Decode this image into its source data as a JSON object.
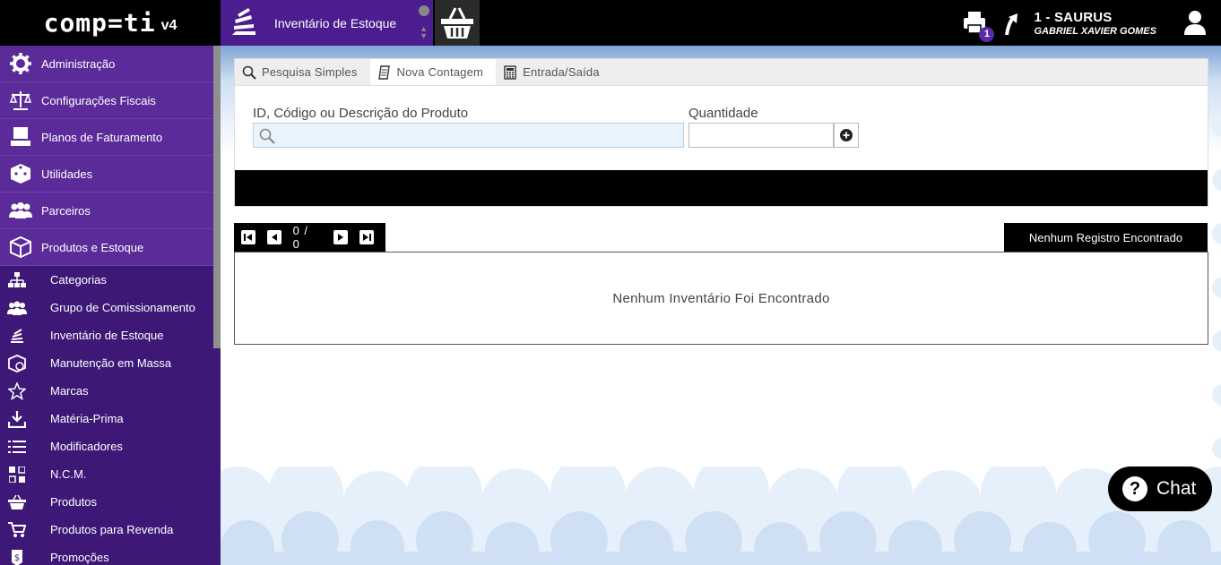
{
  "app": {
    "brand": "comp=ti",
    "version": "v4"
  },
  "open_tab": {
    "label": "Inventário de Estoque"
  },
  "header": {
    "print_badge": "1",
    "company": "1 - SAURUS",
    "user": "GABRIEL XAVIER GOMES"
  },
  "sidebar": {
    "items": [
      {
        "label": "Administração",
        "icon": "gear-icon"
      },
      {
        "label": "Configurações Fiscais",
        "icon": "scales-icon"
      },
      {
        "label": "Planos de Faturamento",
        "icon": "billing-icon"
      },
      {
        "label": "Utilidades",
        "icon": "dice-icon"
      },
      {
        "label": "Parceiros",
        "icon": "people-icon"
      },
      {
        "label": "Produtos e Estoque",
        "icon": "box-icon"
      }
    ],
    "subitems": [
      {
        "label": "Categorias",
        "icon": "hierarchy-icon"
      },
      {
        "label": "Grupo de Comissionamento",
        "icon": "group-icon"
      },
      {
        "label": "Inventário de Estoque",
        "icon": "inventory-icon"
      },
      {
        "label": "Manutenção em Massa",
        "icon": "mass-edit-icon"
      },
      {
        "label": "Marcas",
        "icon": "star-icon"
      },
      {
        "label": "Matéria-Prima",
        "icon": "download-icon"
      },
      {
        "label": "Modificadores",
        "icon": "list-icon"
      },
      {
        "label": "N.C.M.",
        "icon": "grid-icon"
      },
      {
        "label": "Produtos",
        "icon": "basket-icon"
      },
      {
        "label": "Produtos para Revenda",
        "icon": "cart-icon"
      },
      {
        "label": "Promoções",
        "icon": "tag-icon"
      }
    ]
  },
  "tabs": [
    {
      "label": "Pesquisa Simples",
      "icon": "magnifier-icon"
    },
    {
      "label": "Nova Contagem",
      "icon": "notepad-icon"
    },
    {
      "label": "Entrada/Saída",
      "icon": "calculator-icon"
    }
  ],
  "form": {
    "product_label": "ID, Código ou Descrição do Produto",
    "product_value": "",
    "quantity_label": "Quantidade",
    "quantity_value": ""
  },
  "pager": {
    "count": "0 / 0"
  },
  "records_badge": "Nenhum Registro Encontrado",
  "empty_message": "Nenhum Inventário Foi Encontrado",
  "chat": {
    "label": "Chat",
    "icon_glyph": "?"
  },
  "colors": {
    "purple": "#5a2b99",
    "dark_purple": "#3d1877",
    "tab_purple": "#4b1d8e",
    "black": "#000000",
    "sky": "#cfe0f3"
  }
}
